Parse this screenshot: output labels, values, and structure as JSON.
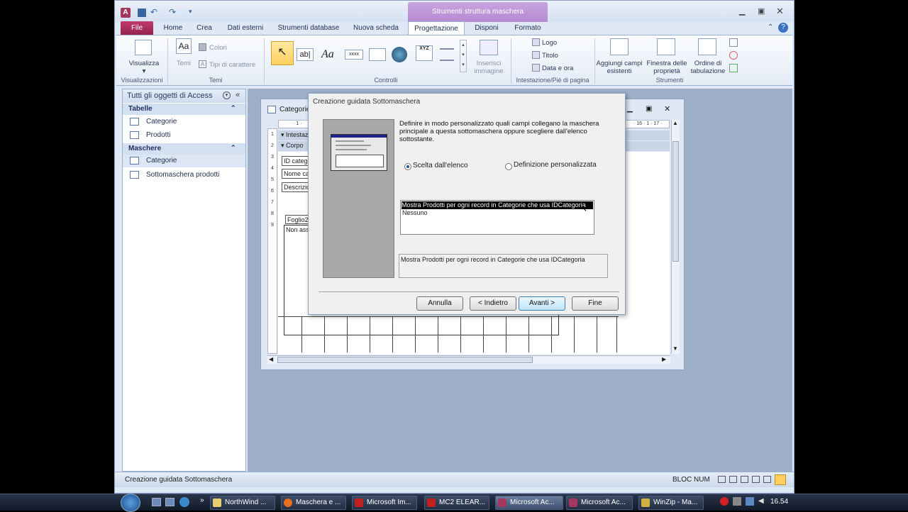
{
  "app": {
    "title": "Microsoft Access",
    "context_tab": "Strumenti struttura maschera"
  },
  "ribbon": {
    "tabs": [
      "File",
      "Home",
      "Crea",
      "Dati esterni",
      "Strumenti database",
      "Nuova scheda",
      "Progettazione",
      "Disponi",
      "Formato"
    ],
    "active_tab": "Progettazione",
    "views": {
      "button": "Visualizza",
      "group": "Visualizzazioni"
    },
    "themes": {
      "button": "Temi",
      "colors": "Colori",
      "fonts": "Tipi di carattere",
      "group": "Temi"
    },
    "controls": {
      "group": "Controlli",
      "insert_image": "Inserisci immagine"
    },
    "header_footer": {
      "logo": "Logo",
      "title": "Titolo",
      "datetime": "Data e ora",
      "group": "Intestazione/Piè di pagina"
    },
    "tools": {
      "add_fields": "Aggiungi campi esistenti",
      "property_sheet": "Finestra delle proprietà",
      "tab_order": "Ordine di tabulazione",
      "group": "Strumenti"
    }
  },
  "nav": {
    "header": "Tutti gli oggetti di Access",
    "sections": [
      {
        "title": "Tabelle",
        "items": [
          "Categorie",
          "Prodotti"
        ]
      },
      {
        "title": "Maschere",
        "items": [
          "Categorie",
          "Sottomaschera prodotti"
        ]
      }
    ]
  },
  "formwin": {
    "title": "Categorie",
    "sections": [
      "Intestazione maschera",
      "Corpo"
    ],
    "fields": [
      "ID categoria",
      "Nome categoria",
      "Descrizione",
      "Foglio2",
      "Non associato"
    ]
  },
  "dialog": {
    "title": "Creazione guidata Sottomaschera",
    "instruction": "Definire in modo personalizzato quali campi collegano la maschera principale a questa sottomaschera oppure scegliere dall'elenco sottostante.",
    "option_list": "Scelta dall'elenco",
    "option_custom": "Definizione personalizzata",
    "list_items": [
      "Mostra Prodotti per ogni record in Categorie che usa IDCategoria",
      "Nessuno"
    ],
    "summary": "Mostra Prodotti per ogni record in Categorie che usa IDCategoria",
    "buttons": {
      "cancel": "Annulla",
      "back": "< Indietro",
      "next": "Avanti >",
      "finish": "Fine"
    }
  },
  "status": {
    "left": "Creazione guidata Sottomaschera",
    "right": "BLOC NUM"
  },
  "taskbar": {
    "items": [
      "NorthWind ...",
      "Maschera e ...",
      "Microsoft Im...",
      "MC2 ELEAR...",
      "Microsoft Ac...",
      "Microsoft Ac...",
      "WinZip - Ma..."
    ],
    "clock": "16.54"
  },
  "colors": {
    "accent": "#b48ad2",
    "file_tab": "#96234f",
    "selection": "#000000"
  }
}
